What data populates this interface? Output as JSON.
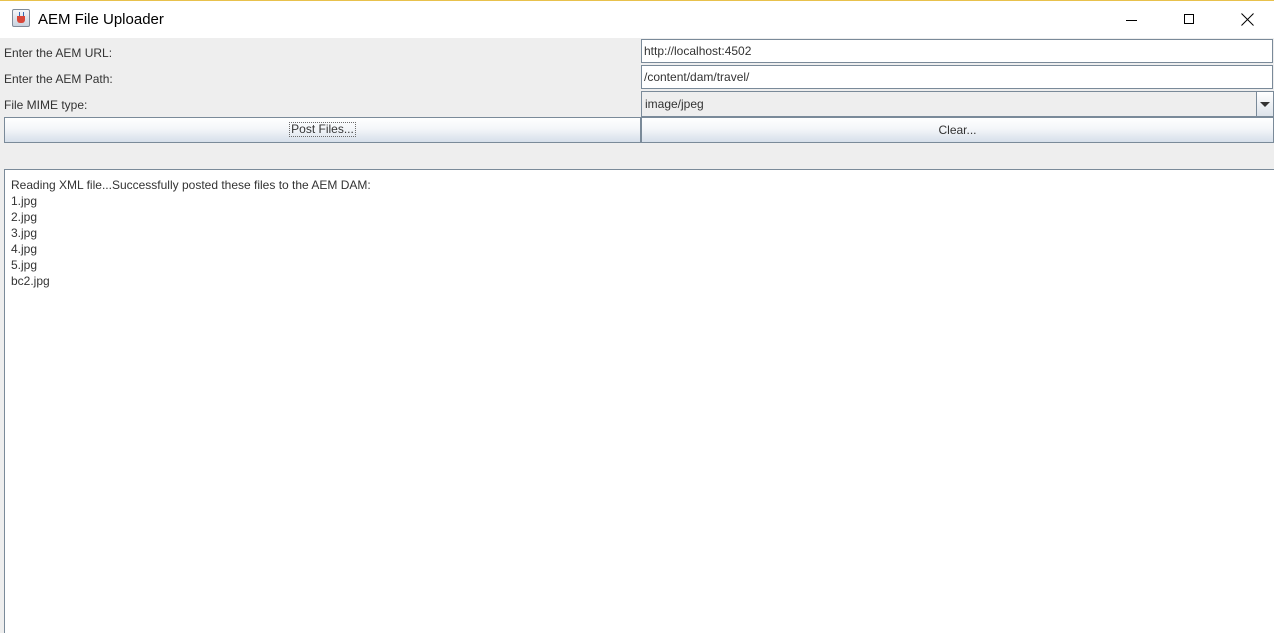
{
  "window": {
    "title": "AEM File Uploader",
    "icon": "java-cup-icon"
  },
  "form": {
    "url_label": "Enter the AEM URL:",
    "url_value": "http://localhost:4502",
    "path_label": "Enter the AEM Path:",
    "path_value": "/content/dam/travel/",
    "mime_label": "File MIME type:",
    "mime_value": "image/jpeg"
  },
  "buttons": {
    "post_label": "Post Files...",
    "clear_label": "Clear..."
  },
  "output": {
    "lines": [
      "Reading XML file...Successfully posted these files to the AEM DAM:",
      "1.jpg",
      "2.jpg",
      "3.jpg",
      "4.jpg",
      "5.jpg",
      "bc2.jpg"
    ]
  },
  "colors": {
    "border": "#7a8a99",
    "panel_background": "#eeeeee",
    "text": "#333333"
  }
}
